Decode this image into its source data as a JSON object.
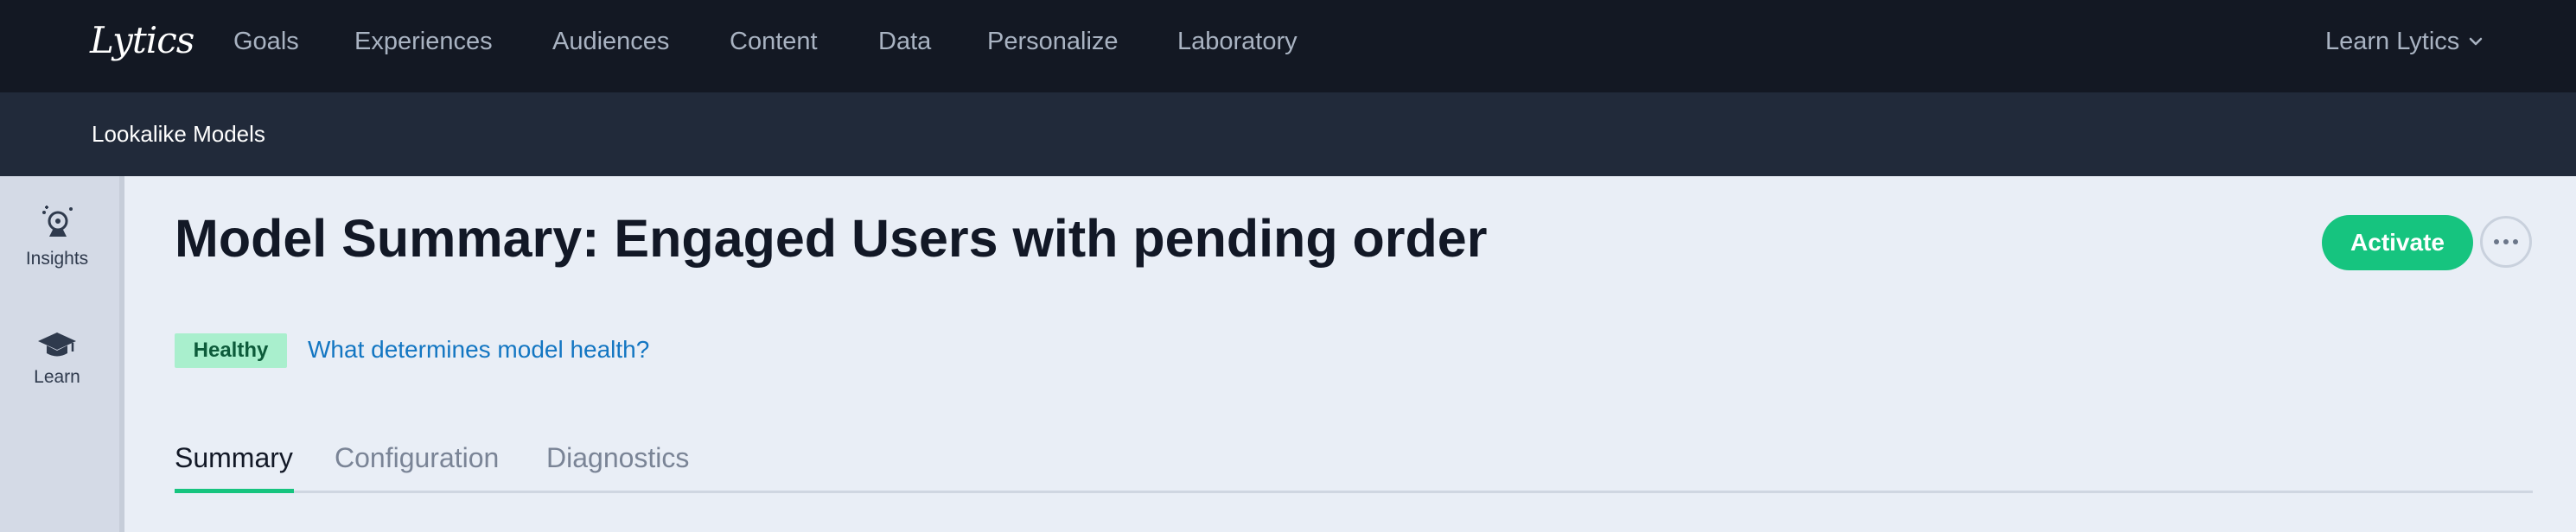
{
  "brand": {
    "logo_text": "Lytics"
  },
  "nav": {
    "items": [
      {
        "label": "Goals"
      },
      {
        "label": "Experiences"
      },
      {
        "label": "Audiences"
      },
      {
        "label": "Content"
      },
      {
        "label": "Data"
      },
      {
        "label": "Personalize"
      },
      {
        "label": "Laboratory"
      }
    ],
    "account_label": "Learn Lytics"
  },
  "subnav": {
    "title": "Lookalike Models"
  },
  "rail": {
    "items": [
      {
        "label": "Insights",
        "icon": "crystal-ball-icon"
      },
      {
        "label": "Learn",
        "icon": "graduation-cap-icon"
      }
    ]
  },
  "main": {
    "title": "Model Summary: Engaged Users with pending order",
    "activate_label": "Activate",
    "status_badge": "Healthy",
    "help_link": "What determines model health?",
    "tabs": [
      {
        "label": "Summary",
        "active": true
      },
      {
        "label": "Configuration",
        "active": false
      },
      {
        "label": "Diagnostics",
        "active": false
      }
    ]
  },
  "colors": {
    "topnav_bg": "#131823",
    "subnav_bg": "#212a3a",
    "page_bg": "#e9eef6",
    "accent_green": "#16c47f",
    "badge_bg": "#a9efcd",
    "link_blue": "#1376c2"
  }
}
